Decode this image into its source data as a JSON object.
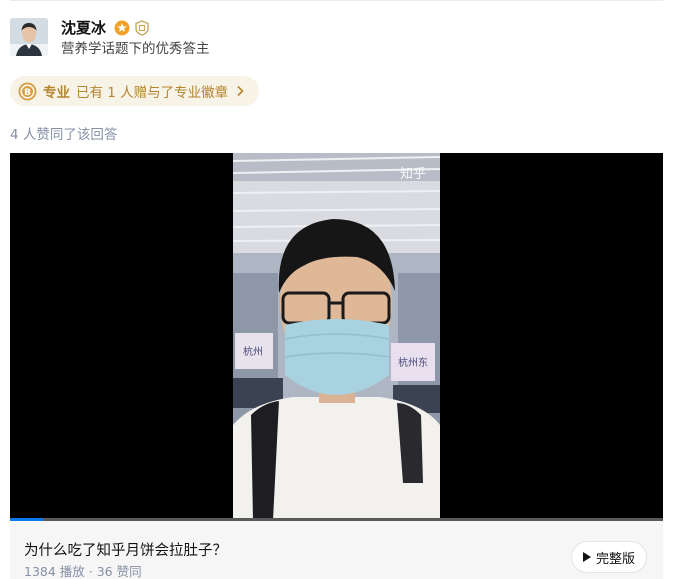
{
  "author": {
    "name": "沈夏冰",
    "description": "营养学话题下的优秀答主"
  },
  "pro_badge": {
    "label": "专业",
    "text": "已有 1 人赠与了专业徽章"
  },
  "likes_text": "4 人赞同了该回答",
  "video": {
    "watermark": "知乎",
    "progress_fraction": 0.05,
    "title": "为什么吃了知乎月饼会拉肚子？",
    "stats": "1384 播放 · 36 赞同",
    "full_button_label": "完整版"
  },
  "colors": {
    "accent_gold": "#b5852f",
    "progress_blue": "#0b7bec",
    "muted_text": "#8590a6"
  }
}
